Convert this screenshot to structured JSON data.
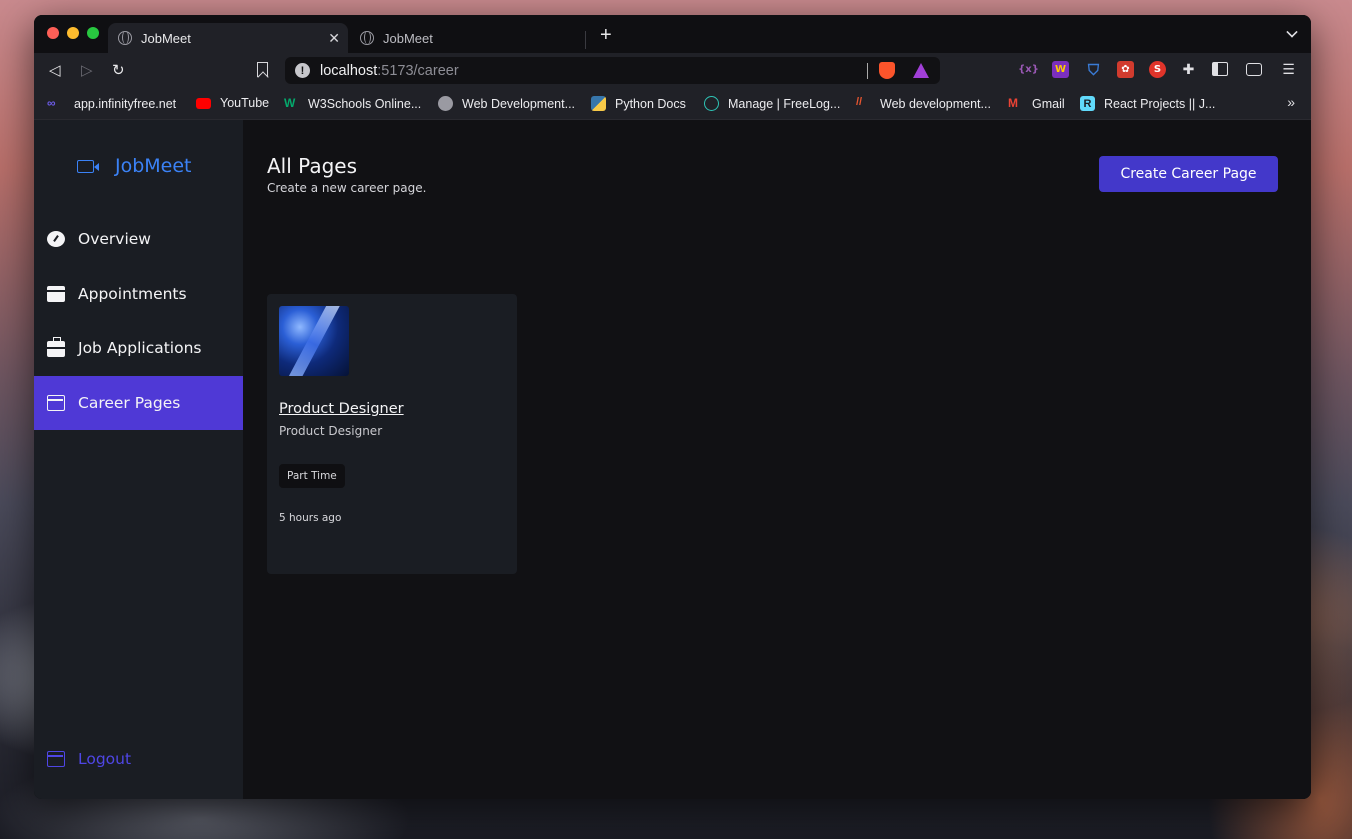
{
  "browser": {
    "tabs": [
      {
        "title": "JobMeet",
        "active": true
      },
      {
        "title": "JobMeet",
        "active": false
      }
    ],
    "url_host": "localhost",
    "url_path": ":5173/career",
    "bookmarks": [
      {
        "label": "app.infinityfree.net",
        "icon": "infinity-icon",
        "color": "#6c5ce7"
      },
      {
        "label": "YouTube",
        "icon": "youtube-icon",
        "color": "#ff0000"
      },
      {
        "label": "W3Schools Online...",
        "icon": "w3schools-icon",
        "color": "#04aa6d"
      },
      {
        "label": "Web Development...",
        "icon": "globe-icon",
        "color": "#9a9aa2"
      },
      {
        "label": "Python Docs",
        "icon": "python-icon",
        "color": "#f7c948"
      },
      {
        "label": "Manage | FreeLog...",
        "icon": "freelogo-icon",
        "color": "#2ec4b6"
      },
      {
        "label": "Web development...",
        "icon": "mdn-icon",
        "color": "#e8552f"
      },
      {
        "label": "Gmail",
        "icon": "gmail-icon",
        "color": "#ea4335"
      },
      {
        "label": "React Projects || J...",
        "icon": "react-projects-icon",
        "color": "#61dafb"
      }
    ]
  },
  "sidebar": {
    "brand": "JobMeet",
    "items": [
      {
        "label": "Overview",
        "icon": "gauge-icon",
        "active": false
      },
      {
        "label": "Appointments",
        "icon": "calendar-icon",
        "active": false
      },
      {
        "label": "Job Applications",
        "icon": "briefcase-icon",
        "active": false
      },
      {
        "label": "Career Pages",
        "icon": "window-icon",
        "active": true
      }
    ],
    "logout": "Logout"
  },
  "main": {
    "title": "All Pages",
    "subtitle": "Create a new career page.",
    "create_button": "Create Career Page",
    "cards": [
      {
        "title": "Product Designer",
        "subtitle": "Product Designer",
        "badge": "Part Time",
        "time": "5 hours ago"
      }
    ]
  },
  "colors": {
    "accent": "#4f39d6",
    "button": "#4338ca",
    "brand": "#3b82f6",
    "logout": "#4f46e5"
  }
}
